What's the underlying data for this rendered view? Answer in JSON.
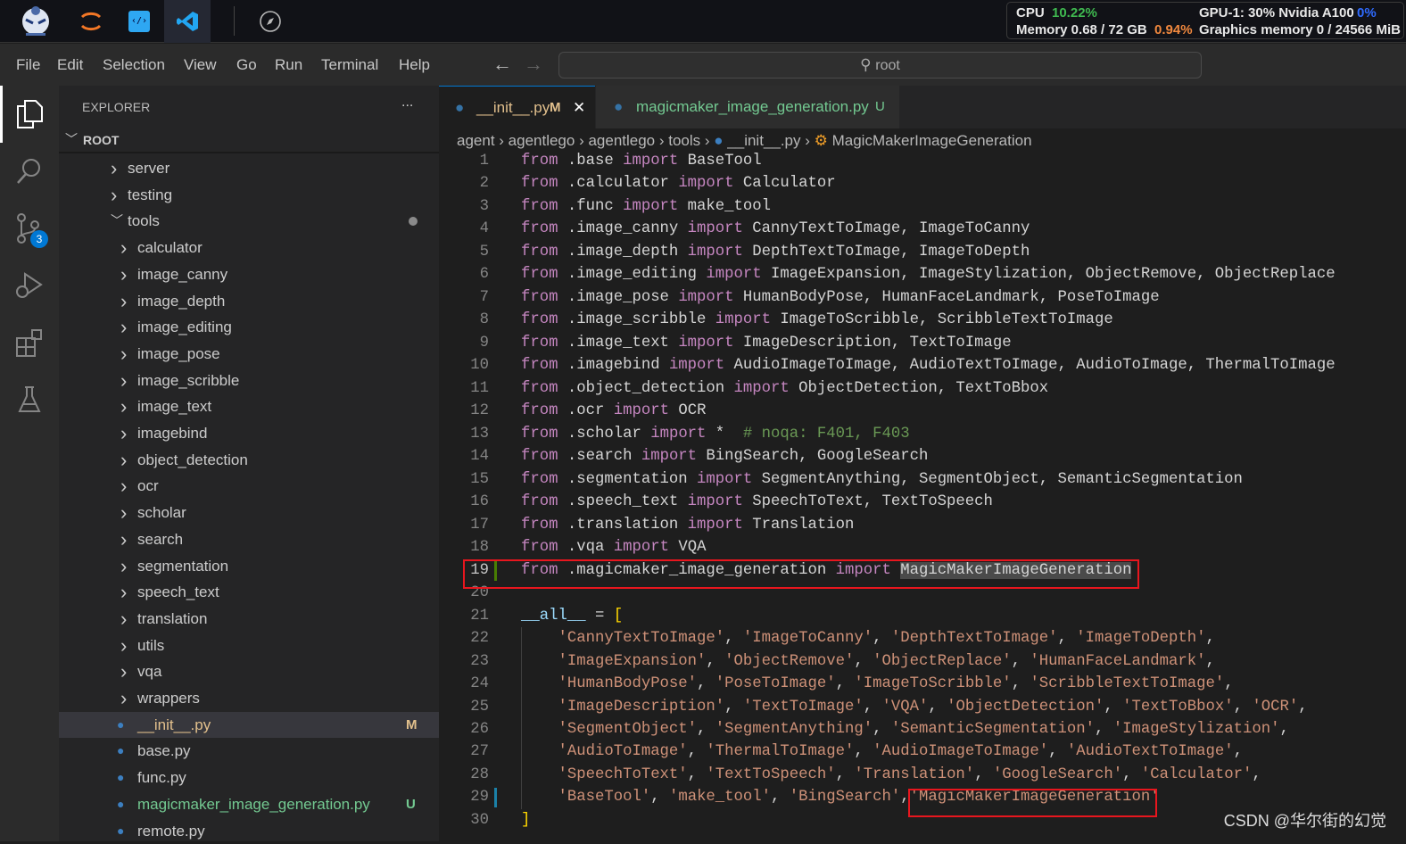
{
  "topbar": {
    "apps": [
      "app-logo",
      "jupyter",
      "code-editor",
      "vscode",
      "compass"
    ]
  },
  "system": {
    "cpu_label": "CPU",
    "cpu_value": "10.22%",
    "memory_label": "Memory 0.68 / 72 GB",
    "memory_value": "0.94%",
    "gpu_label": "GPU-1: 30% Nvidia A100",
    "gpu_value": "0%",
    "gmem_label": "Graphics memory 0 / 24566 MiB",
    "colors": {
      "cpu": "#3fb950",
      "mem": "#f0883e",
      "gpu": "#2f6bff"
    }
  },
  "menu": [
    "File",
    "Edit",
    "Selection",
    "View",
    "Go",
    "Run",
    "Terminal",
    "Help"
  ],
  "search": {
    "placeholder": "root"
  },
  "activity": {
    "badge": "3"
  },
  "explorer": {
    "title": "EXPLORER",
    "more": "...",
    "root": "ROOT",
    "items": [
      {
        "label": "server",
        "type": "folder",
        "depth": 1
      },
      {
        "label": "testing",
        "type": "folder",
        "depth": 1
      },
      {
        "label": "tools",
        "type": "folder-open",
        "depth": 1
      },
      {
        "label": "calculator",
        "type": "folder",
        "depth": 2
      },
      {
        "label": "image_canny",
        "type": "folder",
        "depth": 2
      },
      {
        "label": "image_depth",
        "type": "folder",
        "depth": 2
      },
      {
        "label": "image_editing",
        "type": "folder",
        "depth": 2
      },
      {
        "label": "image_pose",
        "type": "folder",
        "depth": 2
      },
      {
        "label": "image_scribble",
        "type": "folder",
        "depth": 2
      },
      {
        "label": "image_text",
        "type": "folder",
        "depth": 2
      },
      {
        "label": "imagebind",
        "type": "folder",
        "depth": 2
      },
      {
        "label": "object_detection",
        "type": "folder",
        "depth": 2
      },
      {
        "label": "ocr",
        "type": "folder",
        "depth": 2
      },
      {
        "label": "scholar",
        "type": "folder",
        "depth": 2
      },
      {
        "label": "search",
        "type": "folder",
        "depth": 2
      },
      {
        "label": "segmentation",
        "type": "folder",
        "depth": 2
      },
      {
        "label": "speech_text",
        "type": "folder",
        "depth": 2
      },
      {
        "label": "translation",
        "type": "folder",
        "depth": 2
      },
      {
        "label": "utils",
        "type": "folder",
        "depth": 2
      },
      {
        "label": "vqa",
        "type": "folder",
        "depth": 2
      },
      {
        "label": "wrappers",
        "type": "folder",
        "depth": 2
      },
      {
        "label": "__init__.py",
        "type": "file",
        "depth": 2,
        "status": "M",
        "color": "#e2c08d",
        "selected": true
      },
      {
        "label": "base.py",
        "type": "file",
        "depth": 2
      },
      {
        "label": "func.py",
        "type": "file",
        "depth": 2
      },
      {
        "label": "magicmaker_image_generation.py",
        "type": "file",
        "depth": 2,
        "status": "U",
        "color": "#73c991"
      },
      {
        "label": "remote.py",
        "type": "file",
        "depth": 2
      }
    ]
  },
  "tabs": [
    {
      "label": "__init__.py",
      "status": "M",
      "active": true,
      "close": "✕"
    },
    {
      "label": "magicmaker_image_generation.py",
      "status": "U",
      "active": false
    }
  ],
  "breadcrumb": [
    "agent",
    "agentlego",
    "agentlego",
    "tools",
    "__init__.py",
    "MagicMakerImageGeneration"
  ],
  "code": [
    [
      [
        "k",
        "from"
      ],
      [
        "t",
        " .base "
      ],
      [
        "k",
        "import"
      ],
      [
        "t",
        " BaseTool"
      ]
    ],
    [
      [
        "k",
        "from"
      ],
      [
        "t",
        " .calculator "
      ],
      [
        "k",
        "import"
      ],
      [
        "t",
        " Calculator"
      ]
    ],
    [
      [
        "k",
        "from"
      ],
      [
        "t",
        " .func "
      ],
      [
        "k",
        "import"
      ],
      [
        "t",
        " make_tool"
      ]
    ],
    [
      [
        "k",
        "from"
      ],
      [
        "t",
        " .image_canny "
      ],
      [
        "k",
        "import"
      ],
      [
        "t",
        " CannyTextToImage, ImageToCanny"
      ]
    ],
    [
      [
        "k",
        "from"
      ],
      [
        "t",
        " .image_depth "
      ],
      [
        "k",
        "import"
      ],
      [
        "t",
        " DepthTextToImage, ImageToDepth"
      ]
    ],
    [
      [
        "k",
        "from"
      ],
      [
        "t",
        " .image_editing "
      ],
      [
        "k",
        "import"
      ],
      [
        "t",
        " ImageExpansion, ImageStylization, ObjectRemove, ObjectReplace"
      ]
    ],
    [
      [
        "k",
        "from"
      ],
      [
        "t",
        " .image_pose "
      ],
      [
        "k",
        "import"
      ],
      [
        "t",
        " HumanBodyPose, HumanFaceLandmark, PoseToImage"
      ]
    ],
    [
      [
        "k",
        "from"
      ],
      [
        "t",
        " .image_scribble "
      ],
      [
        "k",
        "import"
      ],
      [
        "t",
        " ImageToScribble, ScribbleTextToImage"
      ]
    ],
    [
      [
        "k",
        "from"
      ],
      [
        "t",
        " .image_text "
      ],
      [
        "k",
        "import"
      ],
      [
        "t",
        " ImageDescription, TextToImage"
      ]
    ],
    [
      [
        "k",
        "from"
      ],
      [
        "t",
        " .imagebind "
      ],
      [
        "k",
        "import"
      ],
      [
        "t",
        " AudioImageToImage, AudioTextToImage, AudioToImage, ThermalToImage"
      ]
    ],
    [
      [
        "k",
        "from"
      ],
      [
        "t",
        " .object_detection "
      ],
      [
        "k",
        "import"
      ],
      [
        "t",
        " ObjectDetection, TextToBbox"
      ]
    ],
    [
      [
        "k",
        "from"
      ],
      [
        "t",
        " .ocr "
      ],
      [
        "k",
        "import"
      ],
      [
        "t",
        " OCR"
      ]
    ],
    [
      [
        "k",
        "from"
      ],
      [
        "t",
        " .scholar "
      ],
      [
        "k",
        "import"
      ],
      [
        "t",
        " *  "
      ],
      [
        "c",
        "# noqa: F401, F403"
      ]
    ],
    [
      [
        "k",
        "from"
      ],
      [
        "t",
        " .search "
      ],
      [
        "k",
        "import"
      ],
      [
        "t",
        " BingSearch, GoogleSearch"
      ]
    ],
    [
      [
        "k",
        "from"
      ],
      [
        "t",
        " .segmentation "
      ],
      [
        "k",
        "import"
      ],
      [
        "t",
        " SegmentAnything, SegmentObject, SemanticSegmentation"
      ]
    ],
    [
      [
        "k",
        "from"
      ],
      [
        "t",
        " .speech_text "
      ],
      [
        "k",
        "import"
      ],
      [
        "t",
        " SpeechToText, TextToSpeech"
      ]
    ],
    [
      [
        "k",
        "from"
      ],
      [
        "t",
        " .translation "
      ],
      [
        "k",
        "import"
      ],
      [
        "t",
        " Translation"
      ]
    ],
    [
      [
        "k",
        "from"
      ],
      [
        "t",
        " .vqa "
      ],
      [
        "k",
        "import"
      ],
      [
        "t",
        " VQA"
      ]
    ],
    [
      [
        "k",
        "from"
      ],
      [
        "t",
        " .magicmaker_image_generation "
      ],
      [
        "k",
        "import"
      ],
      [
        "t",
        " "
      ],
      [
        "sel",
        "MagicMakerImageGeneration"
      ]
    ],
    [],
    [
      [
        "v",
        "__all__"
      ],
      [
        "t",
        " = "
      ],
      [
        "b",
        "["
      ]
    ],
    [
      [
        "t",
        "    "
      ],
      [
        "s",
        "'CannyTextToImage'"
      ],
      [
        "t",
        ", "
      ],
      [
        "s",
        "'ImageToCanny'"
      ],
      [
        "t",
        ", "
      ],
      [
        "s",
        "'DepthTextToImage'"
      ],
      [
        "t",
        ", "
      ],
      [
        "s",
        "'ImageToDepth'"
      ],
      [
        "t",
        ","
      ]
    ],
    [
      [
        "t",
        "    "
      ],
      [
        "s",
        "'ImageExpansion'"
      ],
      [
        "t",
        ", "
      ],
      [
        "s",
        "'ObjectRemove'"
      ],
      [
        "t",
        ", "
      ],
      [
        "s",
        "'ObjectReplace'"
      ],
      [
        "t",
        ", "
      ],
      [
        "s",
        "'HumanFaceLandmark'"
      ],
      [
        "t",
        ","
      ]
    ],
    [
      [
        "t",
        "    "
      ],
      [
        "s",
        "'HumanBodyPose'"
      ],
      [
        "t",
        ", "
      ],
      [
        "s",
        "'PoseToImage'"
      ],
      [
        "t",
        ", "
      ],
      [
        "s",
        "'ImageToScribble'"
      ],
      [
        "t",
        ", "
      ],
      [
        "s",
        "'ScribbleTextToImage'"
      ],
      [
        "t",
        ","
      ]
    ],
    [
      [
        "t",
        "    "
      ],
      [
        "s",
        "'ImageDescription'"
      ],
      [
        "t",
        ", "
      ],
      [
        "s",
        "'TextToImage'"
      ],
      [
        "t",
        ", "
      ],
      [
        "s",
        "'VQA'"
      ],
      [
        "t",
        ", "
      ],
      [
        "s",
        "'ObjectDetection'"
      ],
      [
        "t",
        ", "
      ],
      [
        "s",
        "'TextToBbox'"
      ],
      [
        "t",
        ", "
      ],
      [
        "s",
        "'OCR'"
      ],
      [
        "t",
        ","
      ]
    ],
    [
      [
        "t",
        "    "
      ],
      [
        "s",
        "'SegmentObject'"
      ],
      [
        "t",
        ", "
      ],
      [
        "s",
        "'SegmentAnything'"
      ],
      [
        "t",
        ", "
      ],
      [
        "s",
        "'SemanticSegmentation'"
      ],
      [
        "t",
        ", "
      ],
      [
        "s",
        "'ImageStylization'"
      ],
      [
        "t",
        ","
      ]
    ],
    [
      [
        "t",
        "    "
      ],
      [
        "s",
        "'AudioToImage'"
      ],
      [
        "t",
        ", "
      ],
      [
        "s",
        "'ThermalToImage'"
      ],
      [
        "t",
        ", "
      ],
      [
        "s",
        "'AudioImageToImage'"
      ],
      [
        "t",
        ", "
      ],
      [
        "s",
        "'AudioTextToImage'"
      ],
      [
        "t",
        ","
      ]
    ],
    [
      [
        "t",
        "    "
      ],
      [
        "s",
        "'SpeechToText'"
      ],
      [
        "t",
        ", "
      ],
      [
        "s",
        "'TextToSpeech'"
      ],
      [
        "t",
        ", "
      ],
      [
        "s",
        "'Translation'"
      ],
      [
        "t",
        ", "
      ],
      [
        "s",
        "'GoogleSearch'"
      ],
      [
        "t",
        ", "
      ],
      [
        "s",
        "'Calculator'"
      ],
      [
        "t",
        ","
      ]
    ],
    [
      [
        "t",
        "    "
      ],
      [
        "s",
        "'BaseTool'"
      ],
      [
        "t",
        ", "
      ],
      [
        "s",
        "'make_tool'"
      ],
      [
        "t",
        ", "
      ],
      [
        "s",
        "'BingSearch'"
      ],
      [
        "t",
        ","
      ],
      [
        "s",
        "'MagicMakerImageGeneration'"
      ]
    ],
    [
      [
        "b",
        "]"
      ]
    ]
  ],
  "highlight_lines": [
    19
  ],
  "watermark": "CSDN @华尔街的幻觉"
}
